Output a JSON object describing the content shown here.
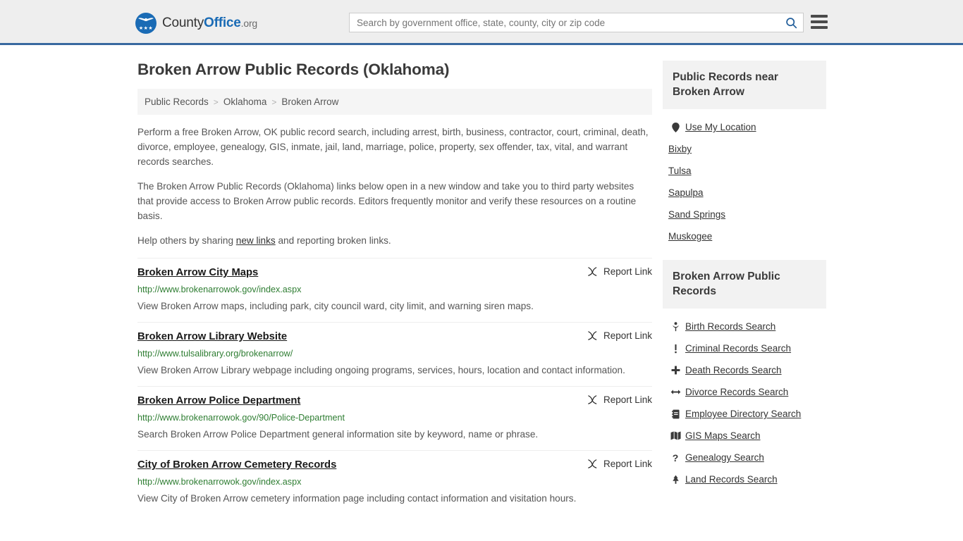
{
  "header": {
    "logo": {
      "text_part1": "County",
      "text_part2": "Office",
      "text_part3": ".org",
      "icon": "eagle-seal-icon"
    },
    "search": {
      "placeholder": "Search by government office, state, county, city or zip code",
      "value": "",
      "button_icon": "search-icon"
    },
    "menu_icon": "hamburger-menu-icon",
    "border_color": "#39699f"
  },
  "main": {
    "title": "Broken Arrow Public Records (Oklahoma)",
    "breadcrumb": {
      "items": [
        "Public Records",
        "Oklahoma",
        "Broken Arrow"
      ],
      "separator": ">"
    },
    "intro_paragraphs": [
      "Perform a free Broken Arrow, OK public record search, including arrest, birth, business, contractor, court, criminal, death, divorce, employee, genealogy, GIS, inmate, jail, land, marriage, police, property, sex offender, tax, vital, and warrant records searches.",
      "The Broken Arrow Public Records (Oklahoma) links below open in a new window and take you to third party websites that provide access to Broken Arrow public records. Editors frequently monitor and verify these resources on a routine basis."
    ],
    "help_line": {
      "before": "Help others by sharing ",
      "link": "new links",
      "after": " and reporting broken links."
    },
    "report_link_label": "Report Link",
    "report_link_icon": "broken-link-icon",
    "results": [
      {
        "title": "Broken Arrow City Maps",
        "url": "http://www.brokenarrowok.gov/index.aspx",
        "description": "View Broken Arrow maps, including park, city council ward, city limit, and warning siren maps."
      },
      {
        "title": "Broken Arrow Library Website",
        "url": "http://www.tulsalibrary.org/brokenarrow/",
        "description": "View Broken Arrow Library webpage including ongoing programs, services, hours, location and contact information."
      },
      {
        "title": "Broken Arrow Police Department",
        "url": "http://www.brokenarrowok.gov/90/Police-Department",
        "description": "Search Broken Arrow Police Department general information site by keyword, name or phrase."
      },
      {
        "title": "City of Broken Arrow Cemetery Records",
        "url": "http://www.brokenarrowok.gov/index.aspx",
        "description": "View City of Broken Arrow cemetery information page including contact information and visitation hours."
      }
    ]
  },
  "sidebar": {
    "nearby": {
      "heading": "Public Records near Broken Arrow",
      "items": [
        {
          "label": "Use My Location",
          "icon": "map-pin-icon"
        },
        {
          "label": "Bixby",
          "icon": ""
        },
        {
          "label": "Tulsa",
          "icon": ""
        },
        {
          "label": "Sapulpa",
          "icon": ""
        },
        {
          "label": "Sand Springs",
          "icon": ""
        },
        {
          "label": "Muskogee",
          "icon": ""
        }
      ]
    },
    "records": {
      "heading": "Broken Arrow Public Records",
      "items": [
        {
          "label": "Birth Records Search",
          "icon": "baby-icon",
          "glyph": "Ɣ"
        },
        {
          "label": "Criminal Records Search",
          "icon": "exclamation-icon",
          "glyph": "!"
        },
        {
          "label": "Death Records Search",
          "icon": "cross-icon",
          "glyph": "✚"
        },
        {
          "label": "Divorce Records Search",
          "icon": "left-right-arrow-icon",
          "glyph": "↔"
        },
        {
          "label": "Employee Directory Search",
          "icon": "address-book-icon",
          "glyph": "▤"
        },
        {
          "label": "GIS Maps Search",
          "icon": "folded-map-icon",
          "glyph": "⬛"
        },
        {
          "label": "Genealogy Search",
          "icon": "question-mark-icon",
          "glyph": "?"
        },
        {
          "label": "Land Records Search",
          "icon": "tree-icon",
          "glyph": "♣"
        }
      ]
    }
  }
}
